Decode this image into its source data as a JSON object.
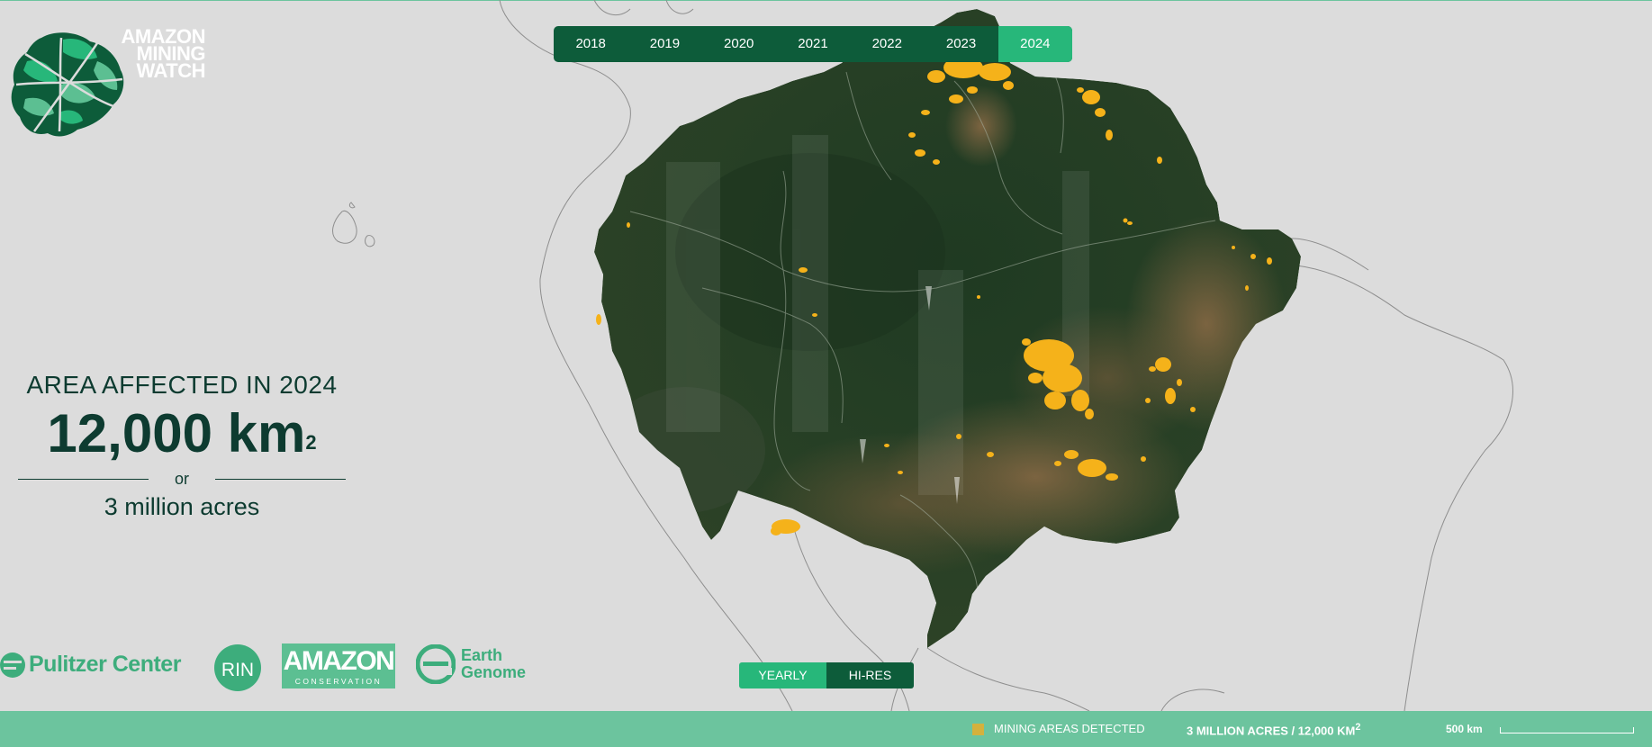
{
  "logo": {
    "lines": [
      "AMAZON",
      "MINING",
      "WATCH"
    ]
  },
  "years": [
    {
      "label": "2018",
      "active": false
    },
    {
      "label": "2019",
      "active": false
    },
    {
      "label": "2020",
      "active": false
    },
    {
      "label": "2021",
      "active": false
    },
    {
      "label": "2022",
      "active": false
    },
    {
      "label": "2023",
      "active": false
    },
    {
      "label": "2024",
      "active": true
    }
  ],
  "stats": {
    "title": "AREA AFFECTED IN 2024",
    "value": "12,000 km",
    "value_sup": "2",
    "or": "or",
    "acres": "3 million acres"
  },
  "partners": {
    "pulitzer": "Pulitzer Center",
    "rin": "RIN",
    "amazon_big": "AMAZON",
    "amazon_small": "CONSERVATION",
    "earth_line1": "Earth",
    "earth_line2": "Genome"
  },
  "mode_toggle": {
    "yearly": "YEARLY",
    "hires": "HI-RES",
    "active": "hires"
  },
  "footer": {
    "legend_label": "MINING AREAS DETECTED",
    "total": "3 MILLION ACRES / 12,000 KM",
    "total_sup": "2",
    "scale_label": "500 km"
  },
  "colors": {
    "background": "#dcdcdc",
    "dark_green": "#0d5c3a",
    "accent_green": "#27b77a",
    "footer_green": "#6cc49e",
    "mining": "#f5b21a",
    "text_dark": "#0d3b30"
  }
}
